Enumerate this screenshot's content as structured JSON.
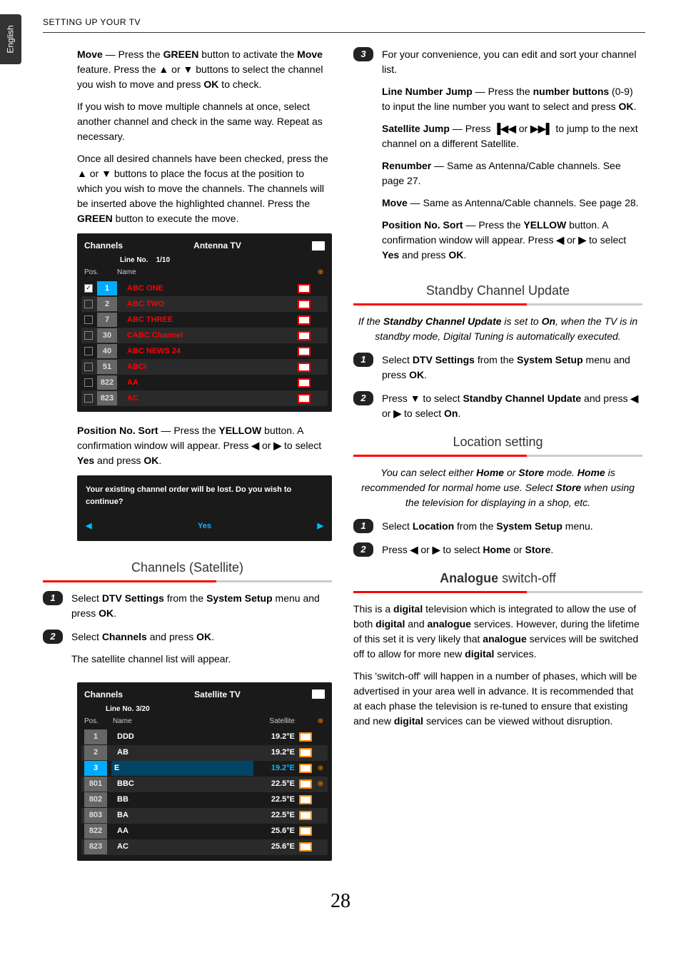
{
  "header": {
    "title": "SETTING UP YOUR TV"
  },
  "sidetab": {
    "label": "English"
  },
  "pagenum": "28",
  "glyphs": {
    "up": "▲",
    "down": "▼",
    "left": "◀",
    "right": "▶",
    "prev": "▐◀◀",
    "next": "▶▶▌"
  },
  "left": {
    "move": {
      "label": "Move",
      "p1_a": " — Press the ",
      "p1_b": "GREEN",
      "p1_c": " button to activate the ",
      "p1_d": "Move",
      "p1_e": " feature. Press the ",
      "p1_f": " or ",
      "p1_g": " buttons to select the channel you wish to move and press ",
      "p1_h": "OK",
      "p1_i": " to check.",
      "p2": "If you wish to move multiple channels at once, select another channel and check in the same way. Repeat as necessary.",
      "p3_a": "Once all desired channels have been checked, press the ",
      "p3_b": " or ",
      "p3_c": " buttons to place the focus at the position to which you wish to move the channels. The channels will be inserted above the highlighted channel. Press the ",
      "p3_d": "GREEN",
      "p3_e": " button to execute the move."
    },
    "osd1": {
      "title": "Channels",
      "source": "Antenna TV",
      "line_label": "Line No.",
      "line_val": "1/10",
      "h_pos": "Pos.",
      "h_name": "Name",
      "rows": [
        {
          "pos": "1",
          "name": "ABC ONE",
          "checked": true,
          "red": true
        },
        {
          "pos": "2",
          "name": "ABC TWO",
          "checked": false,
          "red": true
        },
        {
          "pos": "7",
          "name": "ABC THREE",
          "checked": false,
          "red": true
        },
        {
          "pos": "30",
          "name": "CABC Channel",
          "checked": false,
          "red": true
        },
        {
          "pos": "40",
          "name": "ABC NEWS 24",
          "checked": false,
          "red": true
        },
        {
          "pos": "51",
          "name": "ABCi",
          "checked": false,
          "red": true
        },
        {
          "pos": "822",
          "name": "AA",
          "checked": false,
          "red": true
        },
        {
          "pos": "823",
          "name": "AC",
          "checked": false,
          "red": true
        }
      ]
    },
    "posSort": {
      "label": "Position No. Sort",
      "a": " — Press the ",
      "b": "YELLOW",
      "c": " button. A confirmation window will appear. Press ",
      "d": " or ",
      "e": " to select ",
      "f": "Yes",
      "g": " and press ",
      "h": "OK",
      "i": "."
    },
    "confirm": {
      "q": "Your existing channel order will be lost. Do you wish to continue?",
      "yes": "Yes"
    },
    "satHead": "Channels (Satellite)",
    "step1": {
      "a": "Select ",
      "b": "DTV Settings",
      "c": " from the ",
      "d": "System Setup",
      "e": " menu and press ",
      "f": "OK",
      "g": "."
    },
    "step2": {
      "a": "Select ",
      "b": "Channels",
      "c": " and press ",
      "d": "OK",
      "e": "."
    },
    "step2b": "The  satellite channel list will appear.",
    "osd2": {
      "title": "Channels",
      "source": "Satellite TV",
      "line": "Line No. 3/20",
      "h_pos": "Pos.",
      "h_name": "Name",
      "h_sat": "Satellite",
      "rows": [
        {
          "pos": "1",
          "name": "DDD",
          "sat": "19.2°E",
          "hl": false,
          "icon": false
        },
        {
          "pos": "2",
          "name": "AB",
          "sat": "19.2°E",
          "hl": false,
          "icon": false
        },
        {
          "pos": "3",
          "name": "E",
          "sat": "19.2°E",
          "hl": true,
          "icon": true
        },
        {
          "pos": "801",
          "name": "BBC",
          "sat": "22.5°E",
          "hl": false,
          "icon": true
        },
        {
          "pos": "802",
          "name": "BB",
          "sat": "22.5°E",
          "hl": false,
          "icon": false
        },
        {
          "pos": "803",
          "name": "BA",
          "sat": "22.5°E",
          "hl": false,
          "icon": false
        },
        {
          "pos": "822",
          "name": "AA",
          "sat": "25.6°E",
          "hl": false,
          "icon": false
        },
        {
          "pos": "823",
          "name": "AC",
          "sat": "25.6°E",
          "hl": false,
          "icon": false
        }
      ]
    }
  },
  "right": {
    "step3": {
      "intro": "For your convenience, you can edit and sort your channel list.",
      "lnj": {
        "label": "Line Number Jump",
        "a": " — Press the ",
        "b": "number buttons",
        "c": " (0-9) to input the line number you want to select and press ",
        "d": "OK",
        "e": "."
      },
      "sj": {
        "label": "Satellite Jump",
        "a": " — Press ",
        "b": " or ",
        "c": " to jump to the next channel on a different Satellite."
      },
      "ren": {
        "label": "Renumber",
        "a": " — Same as Antenna/Cable channels. See page 27."
      },
      "mv": {
        "label": "Move",
        "a": " — Same as Antenna/Cable channels. See page 28."
      },
      "ps": {
        "label": "Position No. Sort",
        "a": " — Press the ",
        "b": "YELLOW",
        "c": " button. A confirmation window will appear. Press ",
        "d": " or ",
        "e": " to select ",
        "f": "Yes",
        "g": " and press ",
        "h": "OK",
        "i": "."
      }
    },
    "standby": {
      "head": "Standby Channel Update",
      "intro_a": "If the ",
      "intro_b": "Standby Channel Update",
      "intro_c": " is set to ",
      "intro_d": "On",
      "intro_e": ", when the TV is in standby mode, Digital Tuning is automatically executed.",
      "s1": {
        "a": "Select ",
        "b": "DTV Settings",
        "c": " from the ",
        "d": "System Setup",
        "e": " menu and press ",
        "f": "OK",
        "g": "."
      },
      "s2": {
        "a": "Press ",
        "b": " to select ",
        "c": "Standby Channel Update",
        "d": " and press ",
        "e": " or ",
        "f": " to select ",
        "g": "On",
        "h": "."
      }
    },
    "location": {
      "head": "Location setting",
      "intro_a": "You can select either ",
      "intro_b": "Home",
      "intro_c": " or ",
      "intro_d": "Store",
      "intro_e": " mode. ",
      "intro_f": "Home",
      "intro_g": " is recommended for normal home use. Select ",
      "intro_h": "Store",
      "intro_i": " when using the television for displaying in a shop, etc.",
      "s1": {
        "a": "Select ",
        "b": "Location",
        "c": " from the ",
        "d": "System Setup",
        "e": " menu."
      },
      "s2": {
        "a": "Press ",
        "b": " or ",
        "c": " to select ",
        "d": "Home",
        "e": " or ",
        "f": "Store",
        "g": "."
      }
    },
    "analogue": {
      "head_b": "Analogue",
      "head_r": " switch-off",
      "p1_a": "This is a ",
      "p1_b": "digital",
      "p1_c": " television which is integrated to allow the use of both ",
      "p1_d": "digital",
      "p1_e": " and ",
      "p1_f": "analogue",
      "p1_g": " services. However, during the lifetime of this set it is very likely that ",
      "p1_h": "analogue",
      "p1_i": " services will be switched off to allow for more new ",
      "p1_j": "digital",
      "p1_k": " services.",
      "p2_a": "This 'switch-off' will happen in a number of phases, which will be advertised in your area well in advance. It is recommended that at each phase the television is re-tuned to ensure that existing and new ",
      "p2_b": "digital",
      "p2_c": " services can be viewed without disruption."
    }
  }
}
